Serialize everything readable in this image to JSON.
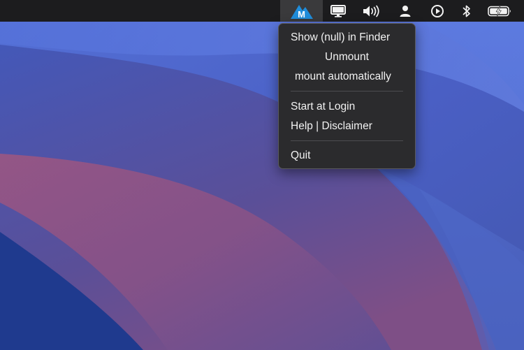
{
  "menubar": {
    "app_icon": "mountain-m-icon",
    "app_icon_letter": "M",
    "status_icons": [
      "display-icon",
      "volume-icon",
      "user-icon",
      "play-circle-icon",
      "bluetooth-icon",
      "battery-charging-icon"
    ]
  },
  "menu": {
    "items": [
      {
        "label": "Show (null) in Finder"
      },
      {
        "label": "Unmount"
      },
      {
        "label": "mount automatically"
      },
      {
        "label": "Start at Login"
      },
      {
        "label": "Help | Disclaimer"
      },
      {
        "label": "Quit"
      }
    ]
  },
  "colors": {
    "menubar": "#1c1c1e",
    "menu_bg": "#2b2b2d",
    "menu_text": "#f2f2f2",
    "app_icon": "#1f8ddb",
    "wallpaper_blue": "#4a66cc",
    "wallpaper_pink": "#9a557d"
  }
}
